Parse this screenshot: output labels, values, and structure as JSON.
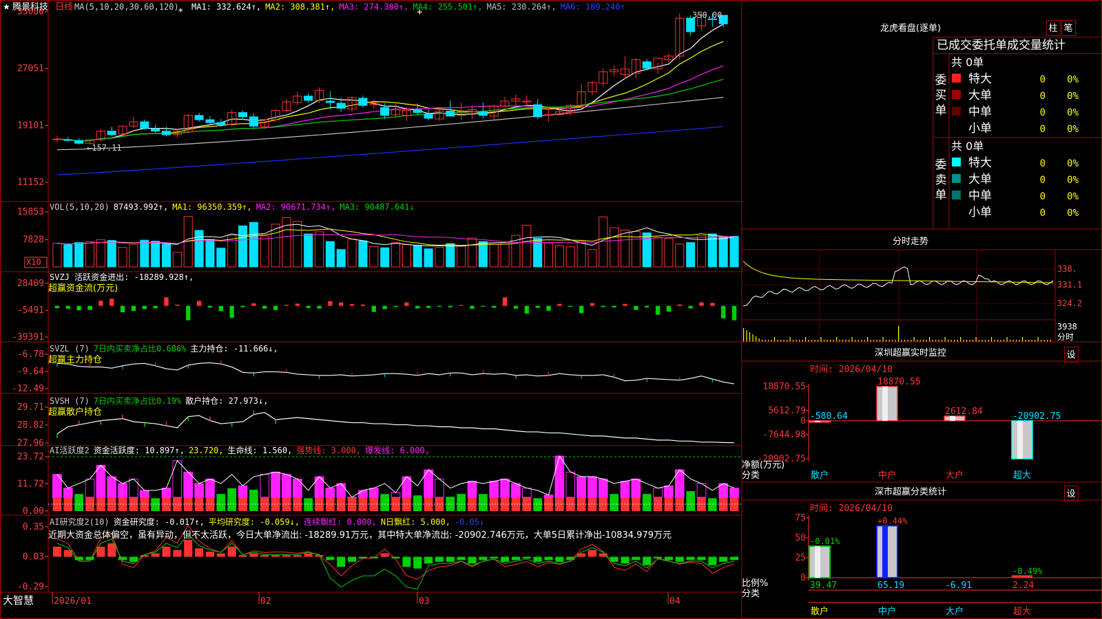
{
  "theme": {
    "bg": "#000000",
    "border": "#b00000",
    "up": "#ff3232",
    "down": "#00e0ff",
    "green": "#00d000",
    "magenta": "#ff20ff",
    "yellow": "#ffff00",
    "white": "#ffffff",
    "blue": "#1020ff",
    "axis": "#ff4040"
  },
  "header": {
    "star": "★",
    "stock_name": "腾景科技",
    "period": "日线",
    "ma_label": "MA(5,10,20,30,60,120)",
    "items": [
      {
        "text": "MA1: 332.624↑,",
        "color": "#ffffff"
      },
      {
        "text": "MA2: 308.381↑,",
        "color": "#ffff00"
      },
      {
        "text": "MA3: 274.380↑,",
        "color": "#ff20ff"
      },
      {
        "text": "MA4: 255.501↑,",
        "color": "#00d000"
      },
      {
        "text": "MA5: 230.264↑,",
        "color": "#c0c0c0"
      },
      {
        "text": "MA6: 189.240↑",
        "color": "#3040ff"
      }
    ]
  },
  "price_panel": {
    "ticks": [
      "35000",
      "27051",
      "19101",
      "11152"
    ],
    "high_label": "350.00",
    "low_label": "157.11"
  },
  "vol_panel": {
    "ticks": [
      "15853",
      "7828"
    ],
    "unit": "X10",
    "header": [
      {
        "text": "VOL(5,10,20)",
        "color": "#d0d0d0"
      },
      {
        "text": "87493.992↑,",
        "color": "#ffffff"
      },
      {
        "text": "MA1: 96350.359↑,",
        "color": "#ffff00"
      },
      {
        "text": "MA2: 90671.734↑,",
        "color": "#ff20ff"
      },
      {
        "text": "MA3: 90487.641↓",
        "color": "#00d000"
      }
    ]
  },
  "svzj_panel": {
    "ticks": [
      "28409",
      "-5491",
      "-39391"
    ],
    "header": [
      {
        "text": "SVZJ  活跃资金进出: -18289.928↑,",
        "color": "#ffffff"
      }
    ],
    "sub": "超赢资金流(万元)"
  },
  "svzl_panel": {
    "ticks": [
      "-6.78",
      "-9.64",
      "-12.49"
    ],
    "header": [
      {
        "text": "SVZL (7)",
        "color": "#d0d0d0"
      },
      {
        "text": "7日内买卖净占比0.686%",
        "color": "#00d000"
      },
      {
        "text": "主力持仓: -11.666↓,",
        "color": "#ffffff"
      }
    ],
    "sub": "超赢主力持仓"
  },
  "svsh_panel": {
    "ticks": [
      "29.71",
      "28.82",
      "27.96"
    ],
    "header": [
      {
        "text": "SVSH (7)",
        "color": "#d0d0d0"
      },
      {
        "text": "7日内买卖净占比0.19%",
        "color": "#00d000"
      },
      {
        "text": "散户持仓: 27.973↓,",
        "color": "#ffffff"
      }
    ],
    "sub": "超赢散户持仓"
  },
  "ai_active_panel": {
    "ticks": [
      "23.72",
      "11.72",
      "0.00"
    ],
    "header": [
      {
        "text": "AI活跃度2",
        "color": "#d0d0d0"
      },
      {
        "text": "资金活跃度: 10.897↑,",
        "color": "#ffffff"
      },
      {
        "text": "23.720,",
        "color": "#ffff00"
      },
      {
        "text": "生命线: 1.560,",
        "color": "#ffffff"
      },
      {
        "text": "强势线: 3.000,",
        "color": "#ff3232"
      },
      {
        "text": "爆发线: 6.000,",
        "color": "#ff20ff"
      }
    ]
  },
  "ai_research_panel": {
    "ticks": [
      "0.35",
      "0.03",
      "-0.29"
    ],
    "header": [
      {
        "text": "AI研究度2(10)",
        "color": "#d0d0d0"
      },
      {
        "text": "资金研究度: -0.017↑,",
        "color": "#ffffff"
      },
      {
        "text": "平均研究度: -0.059↓,",
        "color": "#ffff00"
      },
      {
        "text": "连续飘红: 0.000,",
        "color": "#ff20ff"
      },
      {
        "text": "N日飘红: 5.000,",
        "color": "#ffff00"
      },
      {
        "text": "-0.05↓",
        "color": "#3040ff"
      }
    ],
    "comment": "近期大资金总体偏空，虽有异动，但不太活跃，今日大单净流出: -18289.91万元，其中特大单净流出: -20902.746万元，大单5日累计净出-10834.979万元"
  },
  "date_axis": {
    "brand": "大智慧",
    "labels": [
      "2026/01",
      "02",
      "03",
      "04"
    ]
  },
  "right": {
    "dragon": {
      "title": "龙虎看盘(逐单)",
      "btn1": "柱",
      "btn2": "笔",
      "subtitle": "已成交委托单成交量统计",
      "buy_side": "委买单",
      "sell_side": "委卖单",
      "buy_total": "共 0单",
      "sell_total": "共 0单",
      "buy_rows": [
        {
          "label": "特大",
          "v": "0",
          "p": "0%",
          "c": "#ff2020"
        },
        {
          "label": "大单",
          "v": "0",
          "p": "0%",
          "c": "#a00000"
        },
        {
          "label": "中单",
          "v": "0",
          "p": "0%",
          "c": "#600000"
        },
        {
          "label": "小单",
          "v": "0",
          "p": "0%",
          "c": ""
        }
      ],
      "sell_rows": [
        {
          "label": "特大",
          "v": "0",
          "p": "0%",
          "c": "#00ffff"
        },
        {
          "label": "大单",
          "v": "0",
          "p": "0%",
          "c": "#008f8f"
        },
        {
          "label": "中单",
          "v": "0",
          "p": "0%",
          "c": "#006f6f"
        },
        {
          "label": "小单",
          "v": "0",
          "p": "0%",
          "c": ""
        }
      ]
    },
    "intraday": {
      "title": "分时走势",
      "prices": [
        "338.",
        "331.1",
        "324.2"
      ],
      "vol": "3938",
      "label": "分时"
    },
    "monitor": {
      "title": "深圳超赢实时监控",
      "set": "设",
      "time": "时间: 2026/04/10",
      "yunit": "净额(万元)",
      "xunit": "分类",
      "ticks": [
        "18870.55",
        "5612.79",
        "0",
        "-7644.98",
        "-20902.75"
      ],
      "categories": [
        "散户",
        "中户",
        "大户",
        "超大"
      ],
      "values": [
        "-580.64",
        "18870.55",
        "2612.84",
        "-20902.75"
      ]
    },
    "classify": {
      "title": "深市超赢分类统计",
      "set": "设",
      "time": "时间: 2026/04/10",
      "yunit": "比例%",
      "xunit": "分类",
      "ticks": [
        "75",
        "50",
        "25",
        "0"
      ],
      "categories": [
        "散户",
        "中户",
        "大户",
        "超大"
      ],
      "values": [
        "39.47",
        "65.19",
        "-6.91",
        "2.24"
      ],
      "changes": [
        "-0.01%",
        "+0.44%",
        "",
        "-0.49%"
      ]
    }
  },
  "chart_data": [
    {
      "type": "candlestick",
      "title": "腾景科技 日线",
      "ylim": [
        111.52,
        350.0
      ],
      "note": "prices in yuan; axis ticks 35000/27051/19101/11152 = price x100",
      "dates_span": [
        "2026/01",
        "2026/04/10"
      ],
      "ohlc": [
        [
          172,
          176,
          168,
          172
        ],
        [
          171,
          175,
          168,
          170
        ],
        [
          170,
          173,
          164,
          166
        ],
        [
          166,
          172,
          164,
          171
        ],
        [
          171,
          186,
          169,
          183
        ],
        [
          183,
          189,
          176,
          178
        ],
        [
          179,
          191,
          176,
          190
        ],
        [
          190,
          203,
          187,
          196
        ],
        [
          196,
          199,
          185,
          187
        ],
        [
          186,
          192,
          181,
          183
        ],
        [
          183,
          189,
          176,
          178
        ],
        [
          178,
          185,
          174,
          183
        ],
        [
          182,
          207,
          180,
          205
        ],
        [
          205,
          209,
          196,
          199
        ],
        [
          199,
          204,
          193,
          195
        ],
        [
          195,
          200,
          189,
          192
        ],
        [
          192,
          213,
          190,
          209
        ],
        [
          209,
          212,
          199,
          203
        ],
        [
          203,
          208,
          186,
          190
        ],
        [
          189,
          200,
          186,
          199
        ],
        [
          199,
          214,
          196,
          212
        ],
        [
          212,
          228,
          209,
          224
        ],
        [
          223,
          238,
          219,
          232
        ],
        [
          232,
          236,
          223,
          226
        ],
        [
          226,
          244,
          222,
          240
        ],
        [
          225,
          239,
          213,
          223
        ],
        [
          222,
          230,
          210,
          215
        ],
        [
          214,
          232,
          210,
          230
        ],
        [
          229,
          233,
          216,
          219
        ],
        [
          220,
          227,
          214,
          223
        ],
        [
          216,
          222,
          200,
          205
        ],
        [
          206,
          224,
          201,
          214
        ],
        [
          205,
          217,
          197,
          212
        ],
        [
          213,
          222,
          206,
          209
        ],
        [
          207,
          213,
          198,
          201
        ],
        [
          200,
          214,
          197,
          211
        ],
        [
          211,
          226,
          207,
          204
        ],
        [
          205,
          223,
          199,
          210
        ],
        [
          210,
          219,
          200,
          213
        ],
        [
          210,
          223,
          201,
          205
        ],
        [
          204,
          220,
          198,
          218
        ],
        [
          218,
          231,
          214,
          225
        ],
        [
          225,
          234,
          218,
          228
        ],
        [
          224,
          233,
          217,
          225
        ],
        [
          220,
          228,
          200,
          203
        ],
        [
          206,
          215,
          196,
          206
        ],
        [
          206,
          215,
          205,
          210
        ],
        [
          209,
          221,
          205,
          219
        ],
        [
          219,
          249,
          215,
          238
        ],
        [
          238,
          253,
          233,
          251
        ],
        [
          250,
          271,
          245,
          266
        ],
        [
          266,
          275,
          260,
          269
        ],
        [
          262,
          288,
          256,
          270
        ],
        [
          264,
          285,
          257,
          283
        ],
        [
          280,
          284,
          268,
          271
        ],
        [
          270,
          279,
          263,
          285
        ],
        [
          283,
          292,
          279,
          288
        ],
        [
          288,
          348,
          283,
          341
        ],
        [
          341,
          345,
          317,
          322
        ],
        [
          330,
          350,
          323,
          345
        ],
        [
          340,
          348,
          329,
          339
        ],
        [
          345,
          340,
          328,
          333
        ]
      ],
      "ma_series": [
        {
          "name": "MA1",
          "last": 332.624
        },
        {
          "name": "MA2",
          "last": 308.381
        },
        {
          "name": "MA3",
          "last": 274.38
        },
        {
          "name": "MA4",
          "last": 255.501
        },
        {
          "name": "MA5",
          "last": 230.264
        },
        {
          "name": "MA6",
          "last": 189.24
        }
      ]
    },
    {
      "type": "bar",
      "title": "VOL(5,10,20)",
      "ylim": [
        0,
        15853
      ],
      "values": [
        6800,
        6400,
        7000,
        7200,
        7800,
        7600,
        5600,
        6500,
        7700,
        7400,
        6500,
        4200,
        14500,
        10500,
        7900,
        5400,
        9100,
        11800,
        12800,
        8900,
        12300,
        14200,
        13100,
        9500,
        10100,
        7300,
        5000,
        8000,
        7500,
        5900,
        5500,
        7000,
        6400,
        6200,
        5200,
        5600,
        6700,
        6000,
        8300,
        7300,
        6500,
        7000,
        9100,
        12000,
        8200,
        6900,
        6100,
        5800,
        7300,
        5000,
        14400,
        11300,
        10600,
        10200,
        9800,
        8500,
        8200,
        6600,
        7000,
        9000,
        9500,
        8700,
        8800,
        13600,
        8800
      ]
    },
    {
      "type": "bar",
      "title": "超赢资金流(万元)",
      "ylim": [
        -39391,
        28409
      ],
      "values": [
        -3000,
        -3500,
        -5800,
        -5200,
        6500,
        9000,
        -8200,
        -6400,
        -4000,
        -2900,
        10700,
        1500,
        -18300,
        6200,
        -2200,
        -6600,
        -15200,
        -1800,
        3200,
        -3600,
        -5300,
        1300,
        2800,
        -2800,
        -3400,
        5900,
        4300,
        2100,
        1700,
        -7700,
        -4100,
        -1400,
        4400,
        -3300,
        -2500,
        -1200,
        -1800,
        1100,
        -3700,
        -1100,
        -2400,
        10700,
        -3500,
        -9700,
        -2600,
        -6200,
        2500,
        -1200,
        -9200,
        3500,
        -1600,
        -2000,
        2500,
        -5200,
        -2000,
        -11300,
        -7200,
        1700,
        -3200,
        4400,
        3700,
        -15800,
        -18290
      ]
    },
    {
      "type": "line",
      "title": "超赢主力持仓",
      "ylim": [
        -12.49,
        -6.78
      ],
      "values": [
        -8.3,
        -8.4,
        -8.8,
        -8.9,
        -8.9,
        -9.1,
        -8.7,
        -8.4,
        -8.3,
        -8.7,
        -9.2,
        -9.4,
        -8.6,
        -8.3,
        -8.2,
        -8.4,
        -8.9,
        -9.8,
        -9.9,
        -9.7,
        -9.7,
        -9.8,
        -10.1,
        -10.2,
        -10.3,
        -10.3,
        -10.2,
        -10.4,
        -10.3,
        -10.2,
        -10.0,
        -10.0,
        -10.1,
        -10.3,
        -10.0,
        -10.2,
        -9.9,
        -9.9,
        -10.2,
        -10.0,
        -10.1,
        -10.0,
        -10.3,
        -10.2,
        -10.4,
        -10.3,
        -10.0,
        -10.2,
        -10.3,
        -10.3,
        -10.2,
        -10.6,
        -11.2,
        -11.1,
        -10.8,
        -10.9,
        -11.0,
        -11.1,
        -10.8,
        -10.4,
        -10.9,
        -11.4,
        -11.7
      ]
    },
    {
      "type": "line",
      "title": "超赢散户持仓",
      "ylim": [
        27.96,
        29.71
      ],
      "values": [
        28.4,
        28.75,
        28.85,
        28.95,
        29.05,
        29.1,
        29.15,
        29.0,
        28.95,
        28.9,
        28.8,
        28.7,
        29.25,
        29.3,
        29.05,
        28.9,
        28.95,
        29.0,
        29.35,
        29.45,
        29.1,
        29.15,
        29.2,
        29.15,
        29.1,
        29.05,
        29.0,
        28.95,
        28.95,
        28.9,
        28.9,
        28.85,
        28.85,
        28.8,
        28.8,
        28.75,
        28.75,
        28.7,
        28.7,
        28.65,
        28.65,
        28.6,
        28.55,
        28.5,
        28.5,
        28.45,
        28.45,
        28.4,
        28.35,
        28.3,
        28.3,
        28.25,
        28.2,
        28.2,
        28.15,
        28.1,
        28.1,
        28.05,
        28.05,
        28.0,
        28.0,
        27.98,
        27.97
      ]
    },
    {
      "type": "bar",
      "title": "AI活跃度2",
      "ylim": [
        0,
        23.72
      ],
      "series": [
        {
          "name": "资金活跃度",
          "values": [
            16,
            10,
            12,
            14,
            20,
            15,
            12,
            14,
            9,
            9,
            10,
            22,
            17,
            12,
            14,
            12,
            16,
            11,
            15,
            16,
            17,
            16,
            14,
            9,
            15,
            10,
            12,
            6,
            9,
            10,
            12,
            8,
            15,
            11,
            18,
            14,
            10,
            12,
            13,
            12,
            13,
            14,
            12,
            10,
            9,
            7,
            24,
            17,
            15,
            15,
            14,
            12,
            13,
            14,
            12,
            10,
            11,
            18,
            14,
            12,
            9,
            12,
            10
          ]
        }
      ],
      "lines": [
        {
          "name": "强势线",
          "value": 3.0
        },
        {
          "name": "爆发线",
          "value": 6.0
        },
        {
          "name": "生命线",
          "value": 1.56
        }
      ]
    },
    {
      "type": "bar",
      "title": "AI研究度2(10)",
      "ylim": [
        -0.29,
        0.35
      ],
      "values": [
        0.06,
        0.04,
        -0.02,
        -0.02,
        0.06,
        0.08,
        -0.02,
        -0.03,
        0.01,
        0.02,
        0.06,
        0.04,
        0.1,
        0.05,
        0.03,
        0.02,
        0.06,
        0.01,
        0.02,
        0.01,
        0.01,
        0.01,
        0.01,
        0.02,
        0.01,
        -0.02,
        -0.06,
        -0.03,
        -0.01,
        -0.01,
        0.02,
        -0.01,
        -0.06,
        -0.07,
        -0.04,
        -0.03,
        -0.03,
        -0.02,
        -0.04,
        -0.02,
        -0.01,
        -0.03,
        -0.02,
        -0.01,
        -0.03,
        -0.02,
        -0.03,
        -0.02,
        0.02,
        0.04,
        0.02,
        -0.03,
        -0.04,
        -0.02,
        -0.05,
        -0.01,
        -0.02,
        -0.03,
        -0.02,
        -0.02,
        -0.05,
        -0.03,
        -0.02,
        -0.02
      ]
    }
  ]
}
